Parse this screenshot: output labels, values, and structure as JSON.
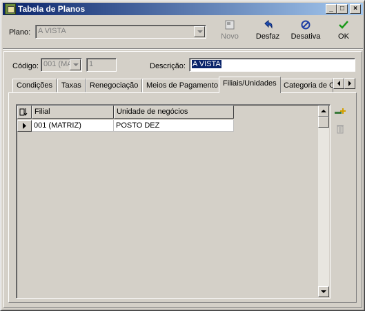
{
  "window": {
    "title": "Tabela de Planos"
  },
  "titlebar_buttons": {
    "minimize": "_",
    "maximize": "□",
    "close": "×"
  },
  "toolbar": {
    "plano_label": "Plano:",
    "plano_value": "A VISTA",
    "novo": "Novo",
    "desfaz": "Desfaz",
    "desativa": "Desativa",
    "ok": "OK"
  },
  "form": {
    "codigo_label": "Código:",
    "codigo_value": "001 (MA",
    "codigo_num": "1",
    "descricao_label": "Descrição:",
    "descricao_value": "A VISTA"
  },
  "tabs": [
    {
      "label": "Condições"
    },
    {
      "label": "Taxas"
    },
    {
      "label": "Renegociação"
    },
    {
      "label": "Meios de Pagamento"
    },
    {
      "label": "Filiais/Unidades"
    },
    {
      "label": "Categoria de C"
    }
  ],
  "active_tab": "Filiais/Unidades",
  "grid": {
    "columns": [
      "Filial",
      "Unidade de negócios"
    ],
    "rows": [
      {
        "filial": "001 (MATRIZ)",
        "unidade": "POSTO DEZ"
      }
    ]
  },
  "colors": {
    "titlebar_start": "#0a246a",
    "titlebar_end": "#a6caf0",
    "selection": "#0a246a",
    "face": "#d4d0c8"
  },
  "icons": {
    "app": "app-icon",
    "novo": "new-document-icon",
    "desfaz": "undo-icon",
    "desativa": "prohibit-icon",
    "ok": "checkmark-icon",
    "add": "add-row-icon",
    "delete": "trash-icon"
  }
}
